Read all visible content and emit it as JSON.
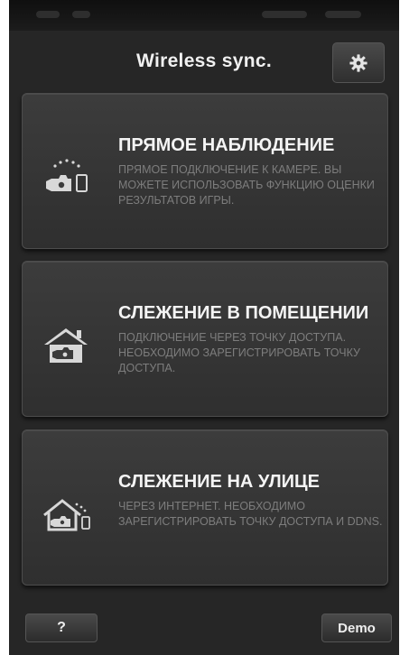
{
  "header": {
    "title": "Wireless sync.",
    "settings_icon": "gear-icon"
  },
  "cards": [
    {
      "title": "ПРЯМОЕ НАБЛЮДЕНИЕ",
      "description": "ПРЯМОЕ ПОДКЛЮЧЕНИЕ К КАМЕРЕ. ВЫ МОЖЕТЕ ИСПОЛЬЗОВАТЬ ФУНКЦИЮ ОЦЕНКИ РЕЗУЛЬТАТОВ ИГРЫ.",
      "icon": "camera-direct-icon"
    },
    {
      "title": "СЛЕЖЕНИЕ В ПОМЕЩЕНИИ",
      "description": "ПОДКЛЮЧЕНИЕ ЧЕРЕЗ ТОЧКУ ДОСТУПА. НЕОБХОДИМО ЗАРЕГИСТРИРОВАТЬ ТОЧКУ ДОСТУПА.",
      "icon": "home-camera-icon"
    },
    {
      "title": "СЛЕЖЕНИЕ НА УЛИЦЕ",
      "description": "ЧЕРЕЗ ИНТЕРНЕТ. НЕОБХОДИМО ЗАРЕГИСТРИРОВАТЬ ТОЧКУ ДОСТУПА И DDNS.",
      "icon": "outdoor-camera-icon"
    }
  ],
  "footer": {
    "help_label": "?",
    "demo_label": "Demo"
  },
  "colors": {
    "background": "#262626",
    "card": "#363636",
    "title_text": "#f4f4f4",
    "description_text": "#7d7d7d"
  }
}
